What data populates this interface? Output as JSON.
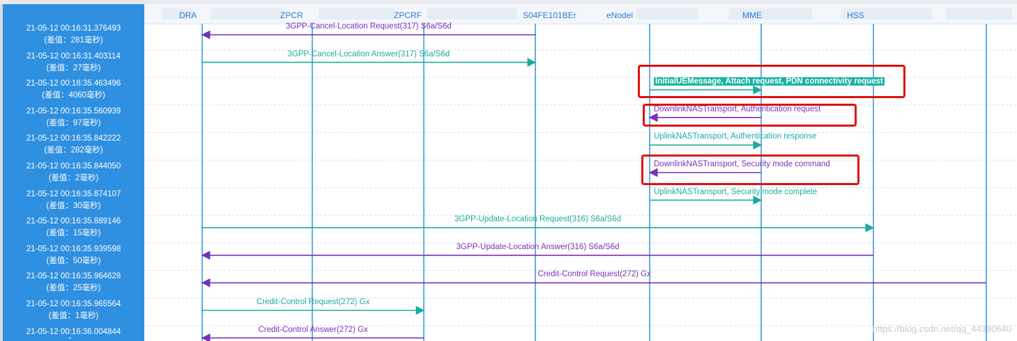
{
  "nodes": [
    {
      "label": "DRA"
    },
    {
      "label": "ZPCR"
    },
    {
      "label": "ZPCRF"
    },
    {
      "label": "S04FE101BEr"
    },
    {
      "label": "eNodel"
    },
    {
      "label": "MME"
    },
    {
      "label": "HSS"
    }
  ],
  "rows": [
    {
      "time": "21-05-12 00:16:31.376493",
      "diff": "(差值：281毫秒)",
      "label": "3GPP-Cancel-Location Request(317) S6a/S6d",
      "from": 3,
      "to": 0,
      "color": "purple"
    },
    {
      "time": "21-05-12 00:16:31.403114",
      "diff": "(差值：27毫秒)",
      "label": "3GPP-Cancel-Location Answer(317) S6a/S6d",
      "from": 0,
      "to": 3,
      "color": "teal"
    },
    {
      "time": "21-05-12 00:16:35.463496",
      "diff": "(差值：4060毫秒)",
      "label": "InitialUEMessage, Attach request, PDN connectivity request",
      "from": 4,
      "to": 5,
      "color": "teal",
      "highlight": true
    },
    {
      "time": "21-05-12 00:16:35.560939",
      "diff": "(差值：97毫秒)",
      "label": "DownlinkNASTransport, Authentication request",
      "from": 5,
      "to": 4,
      "color": "purple"
    },
    {
      "time": "21-05-12 00:16:35.842222",
      "diff": "(差值：282毫秒)",
      "label": "UplinkNASTransport, Authentication response",
      "from": 4,
      "to": 5,
      "color": "teal"
    },
    {
      "time": "21-05-12 00:16:35.844050",
      "diff": "(差值：2毫秒)",
      "label": "DownlinkNASTransport, Security mode command",
      "from": 5,
      "to": 4,
      "color": "purple"
    },
    {
      "time": "21-05-12 00:16:35.874107",
      "diff": "(差值：30毫秒)",
      "label": "UplinkNASTransport, Security mode complete",
      "from": 4,
      "to": 5,
      "color": "teal"
    },
    {
      "time": "21-05-12 00:16:35.889146",
      "diff": "(差值：15毫秒)",
      "label": "3GPP-Update-Location Request(316) S6a/S6d",
      "from": 0,
      "to": 6,
      "color": "teal"
    },
    {
      "time": "21-05-12 00:16:35.939598",
      "diff": "(差值：50毫秒)",
      "label": "3GPP-Update-Location Answer(316) S6a/S6d",
      "from": 6,
      "to": 0,
      "color": "purple"
    },
    {
      "time": "21-05-12 00:16:35.964628",
      "diff": "(差值：25毫秒)",
      "label": "Credit-Control Request(272) Gx",
      "from": 7,
      "to": 0,
      "color": "purple"
    },
    {
      "time": "21-05-12 00:16:35.965564",
      "diff": "(差值：1毫秒)",
      "label": "Credit-Control Request(272) Gx",
      "from": 0,
      "to": 2,
      "color": "teal"
    },
    {
      "time": "21-05-12 00:16:36.004844",
      "diff": "",
      "label": "Credit-Control Answer(272) Gx",
      "from": 2,
      "to": 0,
      "color": "purple"
    }
  ],
  "watermark": "https://blog.csdn.net/qq_44390640",
  "colors": {
    "teal": "#1aab9b",
    "purple": "#7a2fb8",
    "lifeline": "#2d94e0",
    "panel": "#2f8fe0",
    "highlight_box": "#e01010"
  },
  "highlighted_rows": [
    2,
    3,
    5
  ]
}
